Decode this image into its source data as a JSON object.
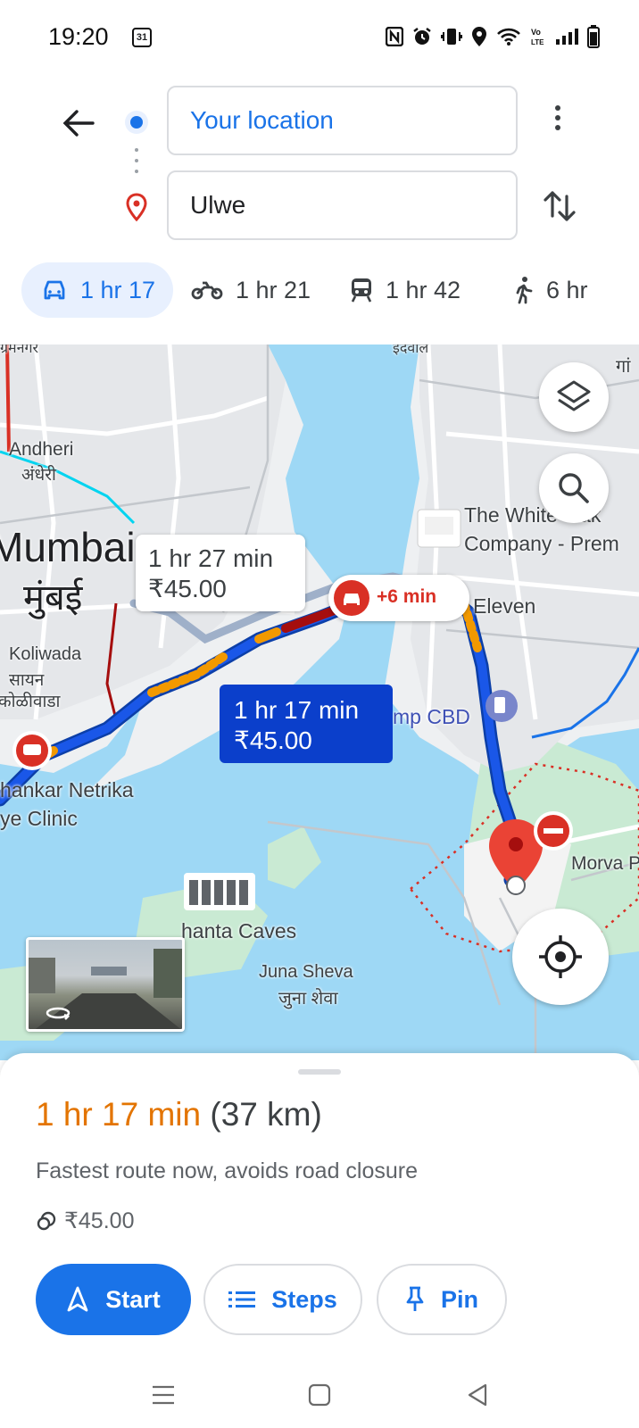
{
  "status_bar": {
    "time": "19:20",
    "calendar_day": "31",
    "icons": [
      "nfc-icon",
      "alarm-icon",
      "vibrate-icon",
      "location-icon",
      "wifi-icon",
      "volte-icon",
      "signal-icon",
      "battery-icon"
    ]
  },
  "directions": {
    "origin": "Your location",
    "destination": "Ulwe"
  },
  "modes": [
    {
      "name": "drive",
      "label": "1 hr 17",
      "active": true
    },
    {
      "name": "motorcycle",
      "label": "1 hr 21",
      "active": false
    },
    {
      "name": "transit",
      "label": "1 hr 42",
      "active": false
    },
    {
      "name": "walk",
      "label": "6 hr",
      "active": false
    }
  ],
  "map": {
    "labels": {
      "andheri_en": "Andheri",
      "andheri_mr": "अंधेरी",
      "mumbai_en": "Mumbai",
      "mumbai_mr": "मुंबई",
      "koliwada_en": "Koliwada",
      "koliwada_mr1": "सायन",
      "koliwada_mr2": "कोळीवाडा",
      "netrika_1": "hankar Netrika",
      "netrika_2": "ye Clinic",
      "whiteoak_1": "The White Oak",
      "whiteoak_2": "Company - Prem",
      "eleven": "Eleven",
      "cbd": "mp CBD",
      "morva": "Morva Pl",
      "caves": "hanta Caves",
      "juna_en": "Juna Sheva",
      "juna_mr": "जुना शेवा",
      "top_left_cut": "ग्रमनगर",
      "top_mid_cut": "इंदवाल",
      "top_right_cut": "गां"
    },
    "alt_route": {
      "time": "1 hr 27 min",
      "toll": "₹45.00"
    },
    "main_route": {
      "time": "1 hr 17 min",
      "toll": "₹45.00"
    },
    "delay": "+6 min",
    "route_color": "#1a57e8",
    "traffic_slow_color": "#f29900",
    "traffic_heavy_color": "#a50e0e"
  },
  "sheet": {
    "duration": "1 hr 17 min",
    "distance": "(37 km)",
    "summary": "Fastest route now, avoids road closure",
    "toll": "₹45.00",
    "buttons": {
      "start": "Start",
      "steps": "Steps",
      "pin": "Pin"
    }
  },
  "colors": {
    "accent": "#1a73e8",
    "eta": "#e37400",
    "alert": "#d93025"
  }
}
